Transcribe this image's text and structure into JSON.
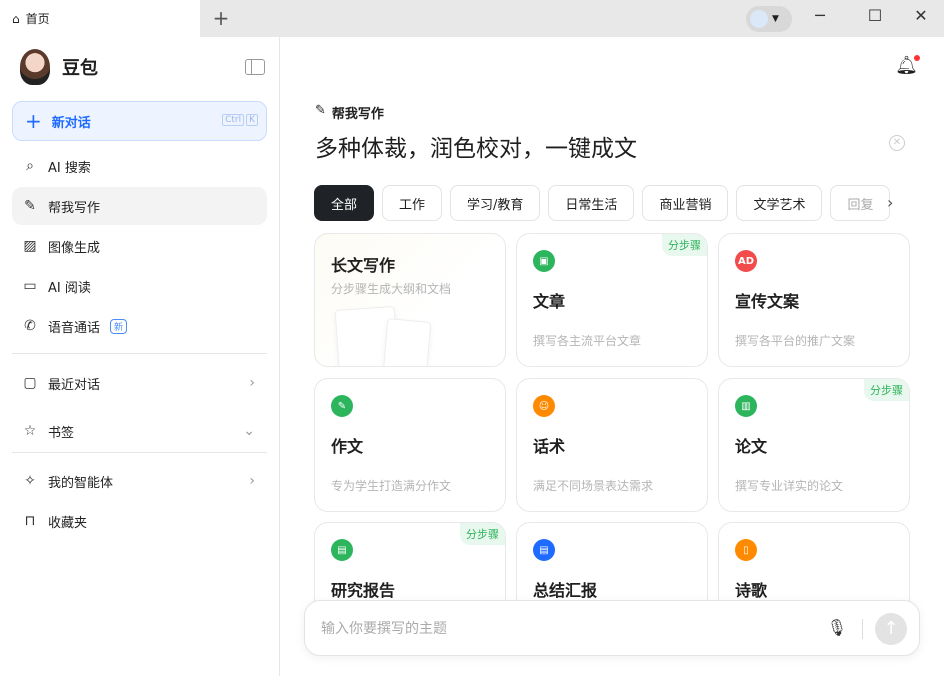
{
  "window": {
    "tab_title": "首页",
    "new_tab": "+",
    "controls": [
      "─",
      "☐",
      "✕"
    ]
  },
  "sidebar": {
    "app_name": "豆包",
    "new_chat": {
      "label": "新对话",
      "keys": [
        "Ctrl",
        "K"
      ]
    },
    "items": [
      {
        "label": "AI 搜索",
        "icon": "ai-search-icon"
      },
      {
        "label": "帮我写作",
        "icon": "write-icon"
      },
      {
        "label": "图像生成",
        "icon": "image-gen-icon"
      },
      {
        "label": "AI 阅读",
        "icon": "ai-read-icon"
      },
      {
        "label": "语音通话",
        "icon": "phone-icon",
        "badge": "新"
      }
    ],
    "recent": "最近对话",
    "bookmarks": "书签",
    "agents": "我的智能体",
    "favorites": "收藏夹"
  },
  "main": {
    "subtitle": "帮我写作",
    "headline": "多种体裁，润色校对，一键成文",
    "categories": [
      "全部",
      "工作",
      "学习/教育",
      "日常生活",
      "商业营销",
      "文学艺术",
      "回复"
    ],
    "cards": [
      {
        "title": "长文写作",
        "desc": "分步骤生成大纲和文档"
      },
      {
        "title": "文章",
        "desc": "撰写各主流平台文章",
        "tag": "分步骤",
        "color": "#2db55d",
        "glyph": "▣"
      },
      {
        "title": "宣传文案",
        "desc": "撰写各平台的推广文案",
        "color": "#f24b4b",
        "glyph": "AD"
      },
      {
        "title": "作文",
        "desc": "专为学生打造满分作文",
        "color": "#2db55d",
        "glyph": "✎"
      },
      {
        "title": "话术",
        "desc": "满足不同场景表达需求",
        "color": "#ff8a00",
        "glyph": "☺"
      },
      {
        "title": "论文",
        "desc": "撰写专业详实的论文",
        "tag": "分步骤",
        "color": "#2db55d",
        "glyph": "▥"
      },
      {
        "title": "研究报告",
        "desc": "",
        "tag": "分步骤",
        "color": "#2db55d",
        "glyph": "▤"
      },
      {
        "title": "总结汇报",
        "desc": "",
        "color": "#1f6bff",
        "glyph": "▤"
      },
      {
        "title": "诗歌",
        "desc": "",
        "color": "#ff8a00",
        "glyph": "▯"
      }
    ],
    "input_placeholder": "输入你要撰写的主题"
  }
}
